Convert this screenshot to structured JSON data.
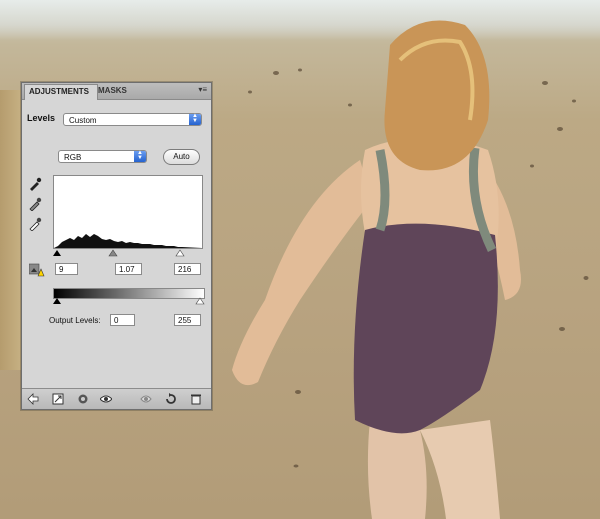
{
  "panel": {
    "tabs": [
      {
        "label": "ADJUSTMENTS",
        "active": true
      },
      {
        "label": "MASKS",
        "active": false
      }
    ],
    "menu_icon": "panel-menu-icon",
    "adjustment_name": "Levels",
    "preset": "Custom",
    "channel": "RGB",
    "auto_label": "Auto",
    "input_levels": {
      "black": "9",
      "gamma": "1.07",
      "white": "216"
    },
    "output_label": "Output Levels:",
    "output_levels": {
      "black": "0",
      "white": "255"
    },
    "bottom_icons": [
      "back-arrow-icon",
      "expand-view-icon",
      "clip-to-layer-icon",
      "visibility-eye-icon",
      "previous-state-icon",
      "reset-icon",
      "delete-trash-icon"
    ]
  },
  "colors": {
    "panel_bg": "#d6d6d6",
    "select_arrow": "#2563cf"
  }
}
